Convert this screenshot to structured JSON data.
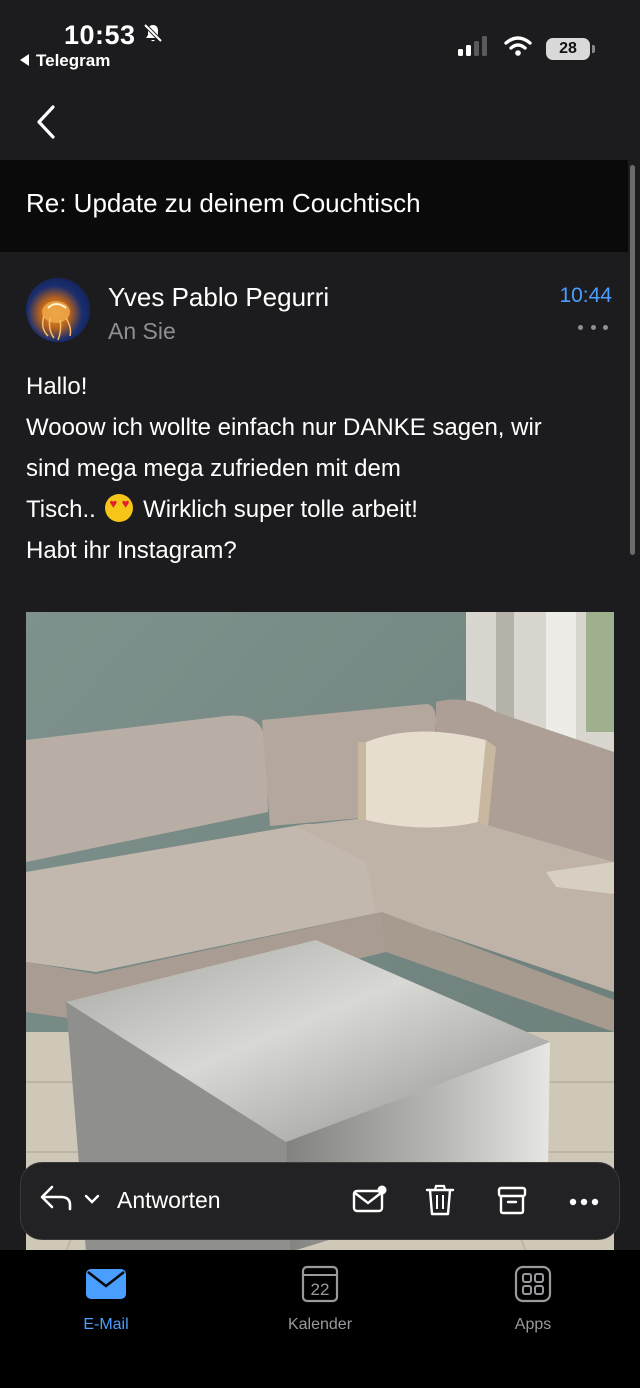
{
  "status_bar": {
    "time": "10:53",
    "back_app": "Telegram",
    "battery": "28"
  },
  "email": {
    "subject": "Re: Update zu deinem Couchtisch",
    "sender_name": "Yves Pablo Pegurri",
    "recipient": "An Sie",
    "time": "10:44",
    "body_lines": [
      "Hallo!",
      "Wooow ich wollte einfach nur DANKE sagen, wir",
      "sind mega mega zufrieden mit dem",
      "Tisch..",
      "Wirklich super tolle arbeit!",
      "Habt ihr Instagram?"
    ]
  },
  "action_bar": {
    "reply_label": "Antworten"
  },
  "tab_bar": {
    "tabs": [
      {
        "label": "E-Mail",
        "icon": "mail-icon",
        "active": true
      },
      {
        "label": "Kalender",
        "icon": "calendar-icon",
        "calendar_day": "22",
        "active": false
      },
      {
        "label": "Apps",
        "icon": "apps-icon",
        "active": false
      }
    ]
  },
  "colors": {
    "accent": "#4a9eff",
    "background": "#1c1c1e",
    "subject_background": "#0a0a0a"
  }
}
